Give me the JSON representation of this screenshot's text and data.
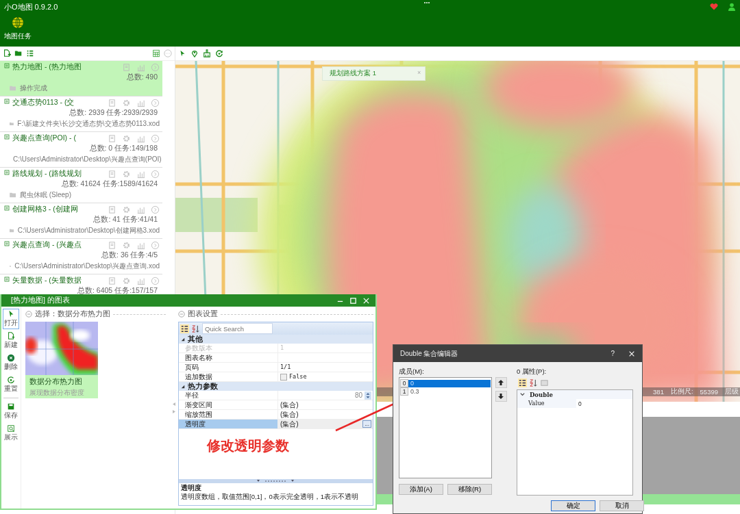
{
  "app": {
    "title": "小O地图 0.9.2.0"
  },
  "ribbon": {
    "label": "地图任务"
  },
  "tasks": [
    {
      "title": "热力地图 - (热力地图",
      "count": "总数: 490",
      "detail": "操作完成",
      "selected": true,
      "configurable": false
    },
    {
      "title": "交通态势0113 - (交",
      "count": "总数: 2939 任务:2939/2939",
      "detail": "F:\\新建文件夹\\长沙交通态势\\交通态势0113.xod",
      "selected": false,
      "configurable": true
    },
    {
      "title": "兴趣点查询(POI) - (",
      "count": "总数: 0 任务:149/198",
      "detail": "C:\\Users\\Administrator\\Desktop\\兴趣点查询(POI)",
      "selected": false,
      "configurable": true
    },
    {
      "title": "路线规划 - (路线规划",
      "count": "总数: 41624 任务:1589/41624",
      "detail": "爬虫休眠 (Sleep)",
      "selected": false,
      "configurable": true
    },
    {
      "title": "创建网格3 - (创建网",
      "count": "总数: 41 任务:41/41",
      "detail": "C:\\Users\\Administrator\\Desktop\\创建网格3.xod",
      "selected": false,
      "configurable": true
    },
    {
      "title": "兴趣点查询 - (兴趣点",
      "count": "总数: 36 任务:4/5",
      "detail": "C:\\Users\\Administrator\\Desktop\\兴趣点查询.xod",
      "selected": false,
      "configurable": true
    },
    {
      "title": "矢量数据 - (矢量数据",
      "count": "总数: 6405 任务:157/157",
      "selected": false,
      "configurable": true
    }
  ],
  "map": {
    "route_tab": "规划路线方案 1",
    "route_tab_close": "×",
    "status": [
      "381",
      "比例尺:",
      "55399",
      "层级"
    ]
  },
  "chart_window": {
    "title": "[热力地图] 的图表",
    "tools": [
      {
        "label": "打开",
        "selected": true
      },
      {
        "label": "新建",
        "selected": false
      },
      {
        "label": "删除",
        "selected": false
      },
      {
        "label": "重置",
        "selected": false
      },
      {
        "label": "保存",
        "selected": false
      },
      {
        "label": "展示",
        "selected": false
      }
    ],
    "gallery_title": "选择：数据分布热力图",
    "charts": [
      {
        "name": "数据分布热力图",
        "description": "展现数据分布密度",
        "selected": true
      }
    ],
    "settings_title": "图表设置",
    "search_placeholder": "Quick Search",
    "categories": [
      {
        "name": "其他",
        "expanded": true,
        "rows": [
          {
            "name": "参数版本",
            "value": "1",
            "kind": "text",
            "disabled": true,
            "selected": false
          },
          {
            "name": "图表名称",
            "kind": "text",
            "disabled": false,
            "selected": false
          },
          {
            "name": "页码",
            "value": "1/1",
            "kind": "text",
            "disabled": false,
            "selected": false
          },
          {
            "name": "追加数据",
            "value": "False",
            "kind": "checkbox",
            "checked": false,
            "disabled": false,
            "selected": false
          }
        ]
      },
      {
        "name": "热力参数",
        "expanded": true,
        "rows": [
          {
            "name": "半径",
            "value": "80",
            "kind": "spinner",
            "disabled": false,
            "selected": false
          },
          {
            "name": "渐变区间",
            "value": "(集合)",
            "kind": "collection",
            "disabled": false,
            "selected": false
          },
          {
            "name": "缩放范围",
            "value": "(集合)",
            "kind": "collection",
            "disabled": false,
            "selected": false
          },
          {
            "name": "透明度",
            "value": "(集合)",
            "kind": "collection",
            "button": "...",
            "disabled": false,
            "selected": true
          }
        ]
      }
    ],
    "help_title": "透明度",
    "help_text": "透明度数组，取值范围[0,1]，0表示完全透明，1表示不透明"
  },
  "annotation": {
    "text": "修改透明参数"
  },
  "collection_editor": {
    "title": "Double 集合编辑器",
    "help": "?",
    "members_label": "成员(M):",
    "members": [
      {
        "index": "0",
        "value": "0",
        "selected": true
      },
      {
        "index": "1",
        "value": "0.3",
        "selected": false
      }
    ],
    "properties_label": "0 属性(P):",
    "category": "Double",
    "property": {
      "name": "Value",
      "value": "0"
    },
    "add": "添加(A)",
    "remove": "移除(R)",
    "ok": "确定",
    "cancel": "取消"
  }
}
